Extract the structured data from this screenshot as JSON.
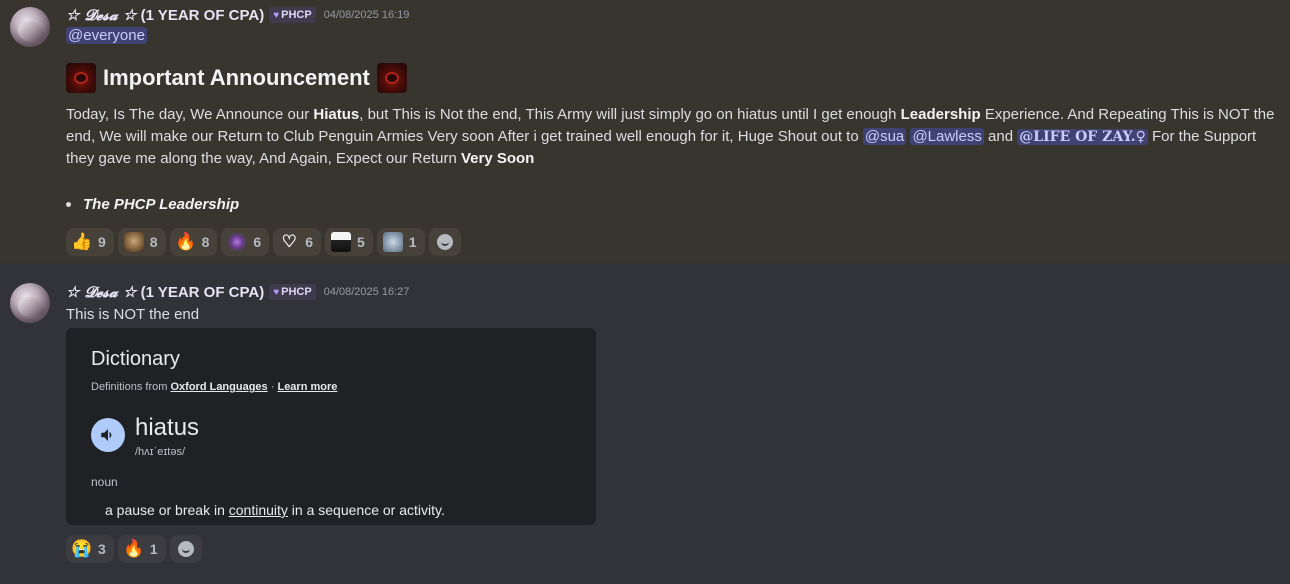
{
  "messages": [
    {
      "author": "☆ 𝓓𝓮𝓼𝓪 ☆",
      "author_suffix": "(1 YEAR OF CPA)",
      "guild_tag": "PHCP",
      "timestamp": "04/08/2025 16:19",
      "mention_everyone": "@everyone",
      "heading": "Important Announcement",
      "paragraph": {
        "t1": "Today, Is The day, We Announce our ",
        "b1": "Hiatus",
        "t2": ", but This is Not the end, This Army will just simply go on hiatus until I get enough ",
        "b2": "Leadership",
        "t3": " Experience. And Repeating This is NOT the end, We will make our Return to Club Penguin Armies Very soon After i get trained well enough for it, Huge Shout out to ",
        "m1": "@sua",
        "t4": " ",
        "m2": "@Lawless",
        "t5": " and ",
        "m3": "@LIFE OF ZAY.♀",
        "t6": " For the Support they gave me along the way, And Again, Expect our Return ",
        "b3": "Very Soon"
      },
      "bullet": "The PHCP Leadership",
      "reactions": [
        {
          "icon": "thumbs-up-emoji",
          "glyph": "👍",
          "count": "9"
        },
        {
          "icon": "custom-emoji-dog",
          "count": "8"
        },
        {
          "icon": "fire-emoji",
          "glyph": "🔥",
          "count": "8"
        },
        {
          "icon": "custom-emoji-purple",
          "count": "6"
        },
        {
          "icon": "white-heart-emoji",
          "glyph": "♡",
          "count": "6"
        },
        {
          "icon": "custom-emoji-bw",
          "count": "5"
        },
        {
          "icon": "custom-emoji-wolf",
          "count": "1"
        }
      ]
    },
    {
      "author": "☆ 𝓓𝓮𝓼𝓪 ☆",
      "author_suffix": "(1 YEAR OF CPA)",
      "guild_tag": "PHCP",
      "timestamp": "04/08/2025 16:27",
      "text": "This is NOT the end",
      "dictionary": {
        "title": "Dictionary",
        "from_prefix": "Definitions from",
        "from_source": "Oxford Languages",
        "separator": "·",
        "learn_more": "Learn more",
        "word": "hiatus",
        "phonetic": "/hʌɪˈeɪtəs/",
        "pos": "noun",
        "def_pre": "a pause or break in ",
        "def_link": "continuity",
        "def_post": " in a sequence or activity."
      },
      "reactions": [
        {
          "icon": "crying-emoji",
          "glyph": "😭",
          "count": "3"
        },
        {
          "icon": "fire-emoji",
          "glyph": "🔥",
          "count": "1"
        }
      ]
    }
  ]
}
